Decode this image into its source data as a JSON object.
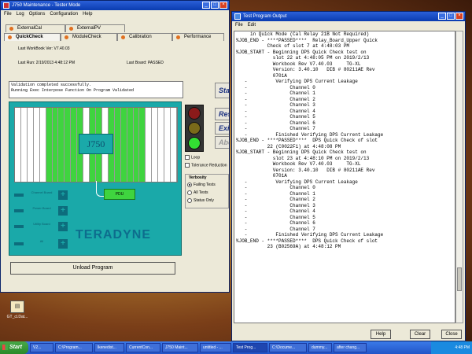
{
  "desktop": {
    "icon_label": "GT_cl.Dat..."
  },
  "main_window": {
    "title": "J750 Maintenance - Tester Mode",
    "menu": [
      "File",
      "Log",
      "Options",
      "Configuration",
      "Help"
    ],
    "tabs_row1": [
      "ExternalCal",
      "ExternalPV"
    ],
    "tabs_row2": [
      "QuickCheck",
      "ModuleCheck",
      "Calibration",
      "Performance"
    ],
    "workbook_version": "Last WorkBook Ver: V7.40.03",
    "last_run": "Last Run: 2/19/2013 4:48:12 PM",
    "last_board": "Last Board: PASSED",
    "status_lines": [
      "Validation completed successfully.",
      "Running Exec Interpose Function On Program Validated"
    ],
    "side_buttons": [
      "Start",
      "Reset",
      "Exit",
      "Abort"
    ],
    "tester_label": "J750",
    "pdu_label": "PDU",
    "legend": [
      "Channel Board",
      "Power Board",
      "Utility Board",
      "All"
    ],
    "logo": "TERADYNE",
    "options": [
      "Loop",
      "Tolerance Reduction"
    ],
    "verbosity": {
      "title": "Verbosity",
      "options": [
        "Failing Tests",
        "All Tests",
        "Status Only"
      ],
      "selected": 0
    },
    "unload_label": "Unload Program",
    "lights": {
      "red": "#8a1a1a",
      "yellow": "#7a6a1a",
      "green": "#33e033"
    }
  },
  "output_window": {
    "title": "Test Program Output",
    "menu": [
      "File",
      "Edit"
    ],
    "lines": [
      "     in Quick Mode (Cal Relay 21B Not Required)",
      "",
      "%JOB_END - ****PASSED****  Relay_Board_Upper Quick",
      "           Check of slot 7 at 4:48:03 PM",
      "",
      "%JOB_START - Beginning DPS Quick Check test on",
      "             slot 22 at 4:48:05 PM on 2019/2/13",
      "             Workbook Rev V7.40.03     TG-XL",
      "             Version: 3.40.10   DIB # 80211AE Rev",
      "             0701A",
      "",
      "   -          Verifying DPS Current Leakage",
      "   -               Channel 0",
      "   -               Channel 1",
      "   -               Channel 2",
      "   -               Channel 3",
      "   -               Channel 4",
      "   -               Channel 5",
      "   -               Channel 6",
      "   -               Channel 7",
      "   -          Finished Verifying DPS Current Leakage",
      "",
      "%JOB_END - ****PASSED****  DPS Quick Check of slot",
      "           22 (C0022F1) at 4:48:08 PM",
      "",
      "%JOB_START - Beginning DPS Quick Check test on",
      "             slot 23 at 4:48:10 PM on 2019/2/13",
      "             Workbook Rev V7.40.03     TG-XL",
      "             Version: 3.40.10   DIB # 80211AE Rev",
      "             0701A",
      "",
      "   -          Verifying DPS Current Leakage",
      "   -               Channel 0",
      "   -               Channel 1",
      "   -               Channel 2",
      "   -               Channel 3",
      "   -               Channel 4",
      "   -               Channel 5",
      "   -               Channel 6",
      "   -               Channel 7",
      "   -          Finished Verifying DPS Current Leakage",
      "",
      "%JOB_END - ****PASSED****  DPS Quick Check of slot",
      "           23 (B02569A) at 4:48:12 PM"
    ],
    "buttons": [
      "Help",
      "Clear",
      "Close"
    ]
  },
  "taskbar": {
    "start_label": "Start",
    "tasks": [
      "V2...",
      "C:\\Program...",
      "lkenedist...",
      "CurrentCon...",
      "J750 Maint...",
      "untitled - ...",
      "Test Prog...",
      "C:\\Docume...",
      "dummy...",
      "after chang..."
    ],
    "active_task": 6,
    "clock": "4:48 PM"
  }
}
